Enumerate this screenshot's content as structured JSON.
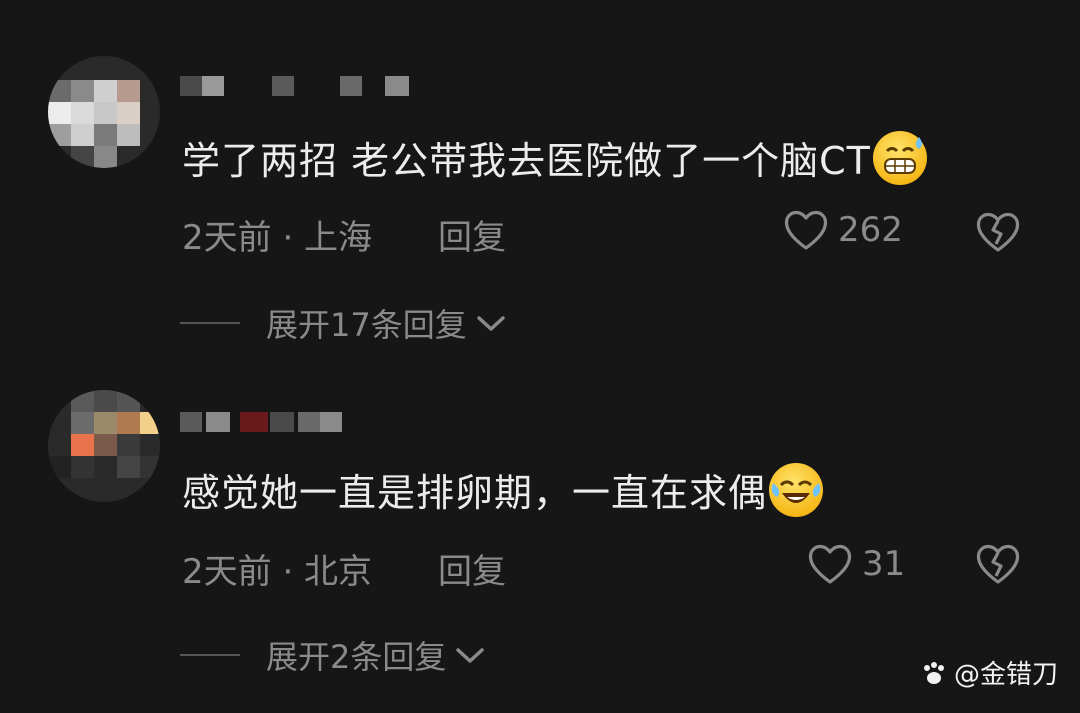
{
  "comments": [
    {
      "text": "学了两招 老公带我去医院做了一个脑CT",
      "emoji": "grimacing-sweat-emoji",
      "meta": "2天前 · 上海",
      "reply_label": "回复",
      "likes": "262",
      "expand_label": "展开17条回复"
    },
    {
      "text": "感觉她一直是排卵期，一直在求偶",
      "emoji": "tears-of-joy-emoji",
      "meta": "2天前 · 北京",
      "reply_label": "回复",
      "likes": "31",
      "expand_label": "展开2条回复"
    }
  ],
  "watermark": "@金错刀",
  "colors": {
    "background": "#161616",
    "text": "#ececec",
    "muted": "#8a8a8a",
    "emoji_yellow": "#f6b91a"
  }
}
